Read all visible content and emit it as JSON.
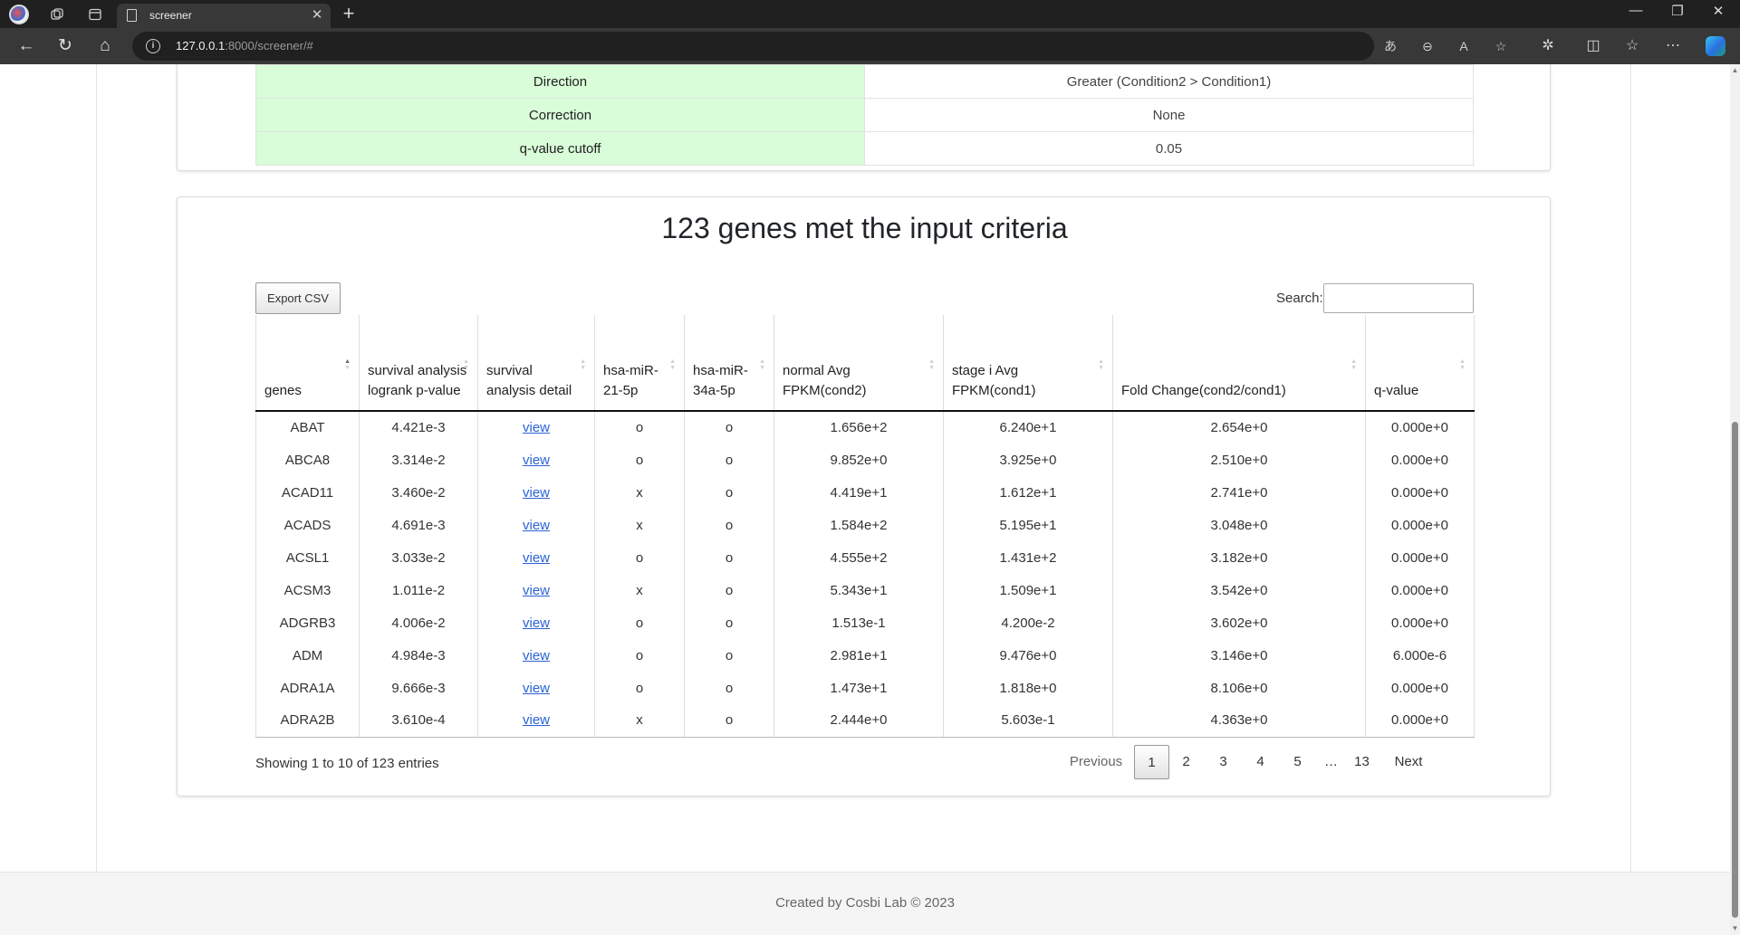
{
  "browser": {
    "tab_title": "screener",
    "url_host": "127.0.0.1",
    "url_path": ":8000/screener/#"
  },
  "params": [
    {
      "label": "Direction",
      "value": "Greater (Condition2 > Condition1)"
    },
    {
      "label": "Correction",
      "value": "None"
    },
    {
      "label": "q-value cutoff",
      "value": "0.05"
    }
  ],
  "results": {
    "title": "123 genes met the input criteria",
    "export_label": "Export CSV",
    "search_label": "Search:",
    "search_value": "",
    "columns": [
      "genes",
      "survival analysis logrank p-value",
      "survival analysis detail",
      "hsa-miR-21-5p",
      "hsa-miR-34a-5p",
      "normal Avg FPKM(cond2)",
      "stage i Avg FPKM(cond1)",
      "Fold Change(cond2/cond1)",
      "q-value"
    ],
    "rows": [
      {
        "gene": "ABAT",
        "pvalue": "4.421e-3",
        "detail": "view",
        "mir21": "o",
        "mir34a": "o",
        "normal": "1.656e+2",
        "stage": "6.240e+1",
        "fold": "2.654e+0",
        "qvalue": "0.000e+0"
      },
      {
        "gene": "ABCA8",
        "pvalue": "3.314e-2",
        "detail": "view",
        "mir21": "o",
        "mir34a": "o",
        "normal": "9.852e+0",
        "stage": "3.925e+0",
        "fold": "2.510e+0",
        "qvalue": "0.000e+0"
      },
      {
        "gene": "ACAD11",
        "pvalue": "3.460e-2",
        "detail": "view",
        "mir21": "x",
        "mir34a": "o",
        "normal": "4.419e+1",
        "stage": "1.612e+1",
        "fold": "2.741e+0",
        "qvalue": "0.000e+0"
      },
      {
        "gene": "ACADS",
        "pvalue": "4.691e-3",
        "detail": "view",
        "mir21": "x",
        "mir34a": "o",
        "normal": "1.584e+2",
        "stage": "5.195e+1",
        "fold": "3.048e+0",
        "qvalue": "0.000e+0"
      },
      {
        "gene": "ACSL1",
        "pvalue": "3.033e-2",
        "detail": "view",
        "mir21": "o",
        "mir34a": "o",
        "normal": "4.555e+2",
        "stage": "1.431e+2",
        "fold": "3.182e+0",
        "qvalue": "0.000e+0"
      },
      {
        "gene": "ACSM3",
        "pvalue": "1.011e-2",
        "detail": "view",
        "mir21": "x",
        "mir34a": "o",
        "normal": "5.343e+1",
        "stage": "1.509e+1",
        "fold": "3.542e+0",
        "qvalue": "0.000e+0"
      },
      {
        "gene": "ADGRB3",
        "pvalue": "4.006e-2",
        "detail": "view",
        "mir21": "o",
        "mir34a": "o",
        "normal": "1.513e-1",
        "stage": "4.200e-2",
        "fold": "3.602e+0",
        "qvalue": "0.000e+0"
      },
      {
        "gene": "ADM",
        "pvalue": "4.984e-3",
        "detail": "view",
        "mir21": "o",
        "mir34a": "o",
        "normal": "2.981e+1",
        "stage": "9.476e+0",
        "fold": "3.146e+0",
        "qvalue": "6.000e-6"
      },
      {
        "gene": "ADRA1A",
        "pvalue": "9.666e-3",
        "detail": "view",
        "mir21": "o",
        "mir34a": "o",
        "normal": "1.473e+1",
        "stage": "1.818e+0",
        "fold": "8.106e+0",
        "qvalue": "0.000e+0"
      },
      {
        "gene": "ADRA2B",
        "pvalue": "3.610e-4",
        "detail": "view",
        "mir21": "x",
        "mir34a": "o",
        "normal": "2.444e+0",
        "stage": "5.603e-1",
        "fold": "4.363e+0",
        "qvalue": "0.000e+0"
      }
    ],
    "info": "Showing 1 to 10 of 123 entries",
    "pagination": {
      "previous": "Previous",
      "pages": [
        "1",
        "2",
        "3",
        "4",
        "5",
        "…",
        "13"
      ],
      "current": "1",
      "next": "Next"
    }
  },
  "footer": {
    "text": "Created by Cosbi Lab © 2023"
  }
}
